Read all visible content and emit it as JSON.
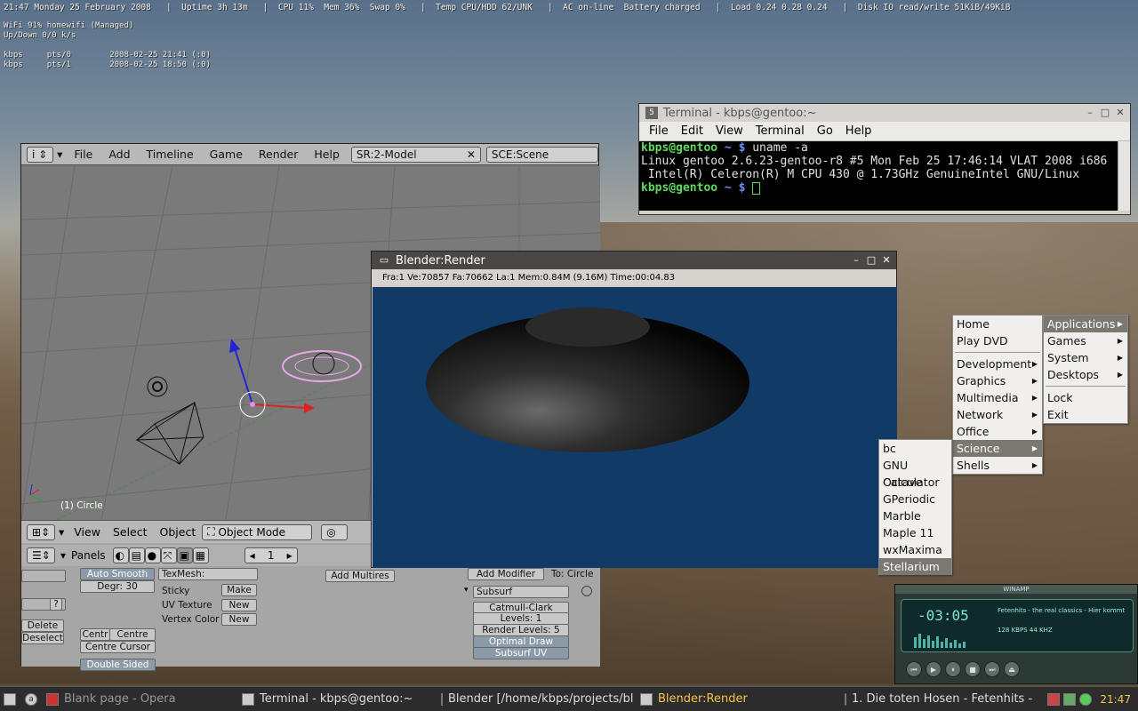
{
  "conky": {
    "status": "21:47 Monday 25 February 2008   |  Uptime 3h 13m   |  CPU 11%  Mem 36%  Swap 0%   |  Temp CPU/HDD 62/UNK   |  AC on-line  Battery charged   |  Load 0.24 0.28 0.24   |  Disk IO read/write 51KiB/49KiB",
    "wifi": "WiFi 91% homewifi (Managed)\nUp/Down 0/0 k/s\n\nkbps     pts/0        2008-02-25 21:41 (:0)\nkbps     pts/1        2008-02-25 18:50 (:0)"
  },
  "terminal": {
    "title": "Terminal - kbps@gentoo:~",
    "menu": [
      "File",
      "Edit",
      "View",
      "Terminal",
      "Go",
      "Help"
    ],
    "prompt_user": "kbps@gentoo",
    "prompt_sym": " ~ $",
    "cmd1": " uname -a",
    "out1": "Linux gentoo 2.6.23-gentoo-r8 #5 Mon Feb 25 17:46:14 VLAT 2008 i686",
    "out2": " Intel(R) Celeron(R) M CPU 430 @ 1.73GHz GenuineIntel GNU/Linux"
  },
  "blender": {
    "menu": [
      "File",
      "Add",
      "Timeline",
      "Game",
      "Render",
      "Help"
    ],
    "screen_field": "SR:2-Model",
    "scene_field": "SCE:Scene",
    "viewport_label": "(1) Circle",
    "header2": [
      "View",
      "Select",
      "Object"
    ],
    "mode": "Object Mode",
    "panels_label": "Panels",
    "frame": "1",
    "auto_smooth": "Auto Smooth",
    "degr": "Degr: 30",
    "texmesh": "TexMesh:",
    "sticky": "Sticky",
    "uv_texture": "UV Texture",
    "vertex_color": "Vertex Color",
    "make": "Make",
    "new": "New",
    "new2": "New",
    "add_multires": "Add Multires",
    "add_modifier": "Add Modifier",
    "to_circle": "To: Circle",
    "subsurf": "Subsurf",
    "catmull": "Catmull-Clark",
    "levels": "Levels: 1",
    "render_levels": "Render Levels: 5",
    "optimal_draw": "Optimal Draw",
    "subsurf_uv": "Subsurf UV",
    "delete": "Delete",
    "deselect": "Deselect",
    "centr": "Centr",
    "centre_new": "Centre New",
    "centre_cursor": "Centre Cursor",
    "double_sided": "Double Sided",
    "q": "?"
  },
  "render": {
    "title": "Blender:Render",
    "info": "Fra:1   Ve:70857  Fa:70662  La:1  Mem:0.84M (9.16M) Time:00:04.83"
  },
  "menu_main": {
    "items": [
      "Home",
      "Play DVD",
      "Development",
      "Graphics",
      "Multimedia",
      "Network",
      "Office",
      "Science",
      "Shells"
    ]
  },
  "menu_apps": {
    "items": [
      "Applications",
      "Games",
      "System",
      "Desktops",
      "Lock",
      "Exit"
    ]
  },
  "menu_science": {
    "items": [
      "bc",
      "GNU Octave",
      "Calculator",
      "GPeriodic",
      "Marble",
      "Maple 11",
      "wxMaxima",
      "Stellarium"
    ]
  },
  "winamp": {
    "title": "WINAMP",
    "time": "-03:05",
    "song": "Fetenhits - the real classics - Hier kommt",
    "kbps": "128  KBPS   44  KHZ"
  },
  "taskbar": {
    "items": [
      "Blank page - Opera",
      "Terminal - kbps@gentoo:~",
      "Blender [/home/kbps/projects/bl",
      "Blender:Render",
      "1. Die toten Hosen - Fetenhits -"
    ],
    "clock": "21:47"
  }
}
